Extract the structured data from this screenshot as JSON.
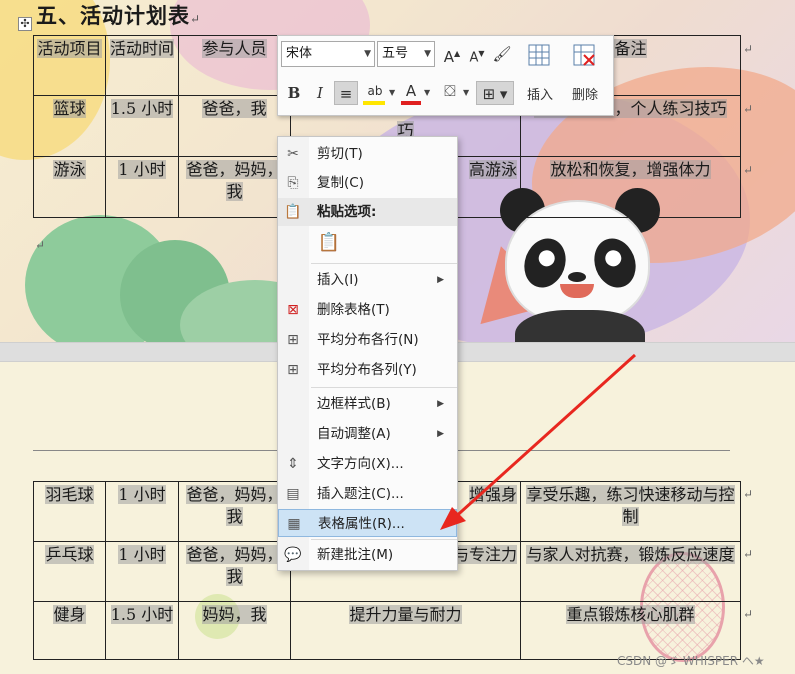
{
  "document": {
    "heading": "五、活动计划表",
    "para_mark": "↵",
    "move_handle_glyph": "✣",
    "table1": {
      "headers": [
        "活动项目",
        "活动时间",
        "参与人员",
        "",
        "备注"
      ],
      "rows": [
        [
          "篮球",
          "1.5 小时",
          "爸爸，我",
          "巧",
          "比赛和练习，个人练习技巧"
        ],
        [
          "游泳",
          "1 小时",
          "爸爸，妈妈，我",
          "高游泳",
          "放松和恢复，增强体力"
        ]
      ]
    },
    "table2": {
      "rows": [
        [
          "羽毛球",
          "1 小时",
          "爸爸，妈妈，我",
          "增强身",
          "享受乐趣，练习快速移动与控制"
        ],
        [
          "乒乓球",
          "1 小时",
          "爸爸，妈妈，我",
          "提高球技与专注力",
          "与家人对抗赛，锻炼反应速度"
        ],
        [
          "健身",
          "1.5 小时",
          "妈妈，我",
          "提升力量与耐力",
          "重点锻炼核心肌群"
        ]
      ]
    }
  },
  "mini_toolbar": {
    "font_name": "宋体",
    "font_size": "五号",
    "grow_font": "A",
    "shrink_font": "A",
    "bold": "B",
    "italic": "I",
    "center": "≡",
    "highlight": "ab",
    "font_color": "A",
    "insert_label": "插入",
    "delete_label": "删除",
    "highlight_color": "#ffe600",
    "font_color_value": "#e02020"
  },
  "context_menu": {
    "items": [
      {
        "label": "剪切(T)",
        "icon": "scissors-icon"
      },
      {
        "label": "复制(C)",
        "icon": "copy-icon"
      },
      {
        "label": "粘贴选项:",
        "icon": "paste-icon"
      },
      {
        "label": "插入(I)",
        "icon": "",
        "submenu": true
      },
      {
        "label": "删除表格(T)",
        "icon": "delete-table-icon"
      },
      {
        "label": "平均分布各行(N)",
        "icon": "distribute-rows-icon"
      },
      {
        "label": "平均分布各列(Y)",
        "icon": "distribute-columns-icon"
      },
      {
        "label": "边框样式(B)",
        "icon": "",
        "submenu": true
      },
      {
        "label": "自动调整(A)",
        "icon": "",
        "submenu": true
      },
      {
        "label": "文字方向(X)...",
        "icon": "text-direction-icon"
      },
      {
        "label": "插入题注(C)...",
        "icon": "caption-icon"
      },
      {
        "label": "表格属性(R)...",
        "icon": "table-properties-icon",
        "highlighted": true
      },
      {
        "label": "新建批注(M)",
        "icon": "comment-icon"
      }
    ]
  },
  "watermark": "CSDN @ゞ WHISPER ヘ★",
  "colors": {
    "menu_hover": "#cde3f5",
    "arrow": "#e8271f"
  }
}
